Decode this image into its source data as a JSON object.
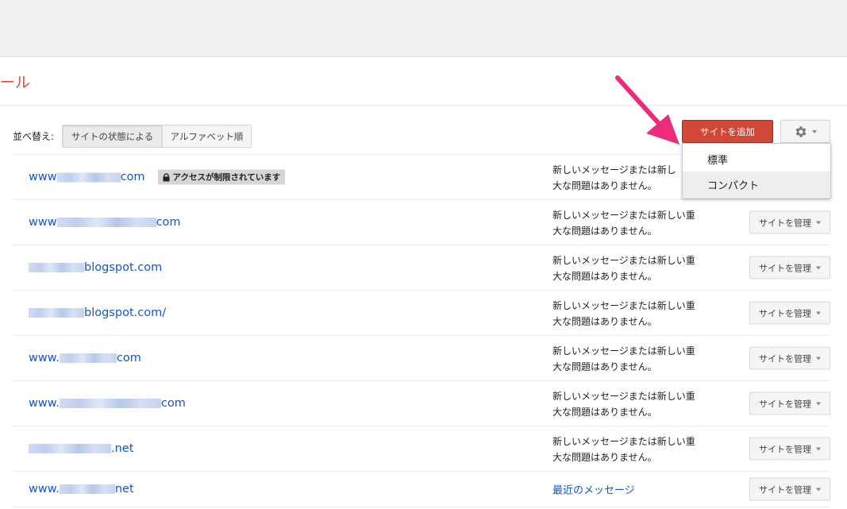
{
  "header": {
    "title_fragment": "ール"
  },
  "sort": {
    "label": "並べ替え:",
    "options": [
      {
        "label": "サイトの状態による",
        "active": true
      },
      {
        "label": "アルファベット順",
        "active": false
      }
    ]
  },
  "toolbar": {
    "add_site_label": "サイトを追加",
    "settings_icon": "gear-icon"
  },
  "display_menu": {
    "items": [
      {
        "label": "標準"
      },
      {
        "label": "コンパクト",
        "highlighted": true
      }
    ]
  },
  "colors": {
    "brand_red": "#dd4b39",
    "add_button": "#d14836",
    "link_blue": "#1155cc",
    "arrow_pink": "#ee2a7b"
  },
  "sites": [
    {
      "prefix": "www",
      "suffix": "com",
      "badge": "アクセスが制限されています",
      "message": [
        "新しいメッセージまたは新し",
        "大な問題はありません。"
      ],
      "manage_label": ""
    },
    {
      "prefix": "www",
      "suffix": "com",
      "message": [
        "新しいメッセージまたは新しい重",
        "大な問題はありません。"
      ],
      "manage_label": "サイトを管理"
    },
    {
      "prefix": "",
      "suffix": "blogspot.com",
      "message": [
        "新しいメッセージまたは新しい重",
        "大な問題はありません。"
      ],
      "manage_label": "サイトを管理"
    },
    {
      "prefix": "",
      "suffix": "blogspot.com/",
      "message": [
        "新しいメッセージまたは新しい重",
        "大な問題はありません。"
      ],
      "manage_label": "サイトを管理"
    },
    {
      "prefix": "www.",
      "suffix": "com",
      "message": [
        "新しいメッセージまたは新しい重",
        "大な問題はありません。"
      ],
      "manage_label": "サイトを管理"
    },
    {
      "prefix": "www.",
      "suffix": "com",
      "message": [
        "新しいメッセージまたは新しい重",
        "大な問題はありません。"
      ],
      "manage_label": "サイトを管理"
    },
    {
      "prefix": "",
      "suffix": ".net",
      "message": [
        "新しいメッセージまたは新しい重",
        "大な問題はありません。"
      ],
      "manage_label": "サイトを管理"
    },
    {
      "prefix": "www.",
      "suffix": "net",
      "message_link": "最近のメッセージ",
      "manage_label": "サイトを管理"
    }
  ]
}
